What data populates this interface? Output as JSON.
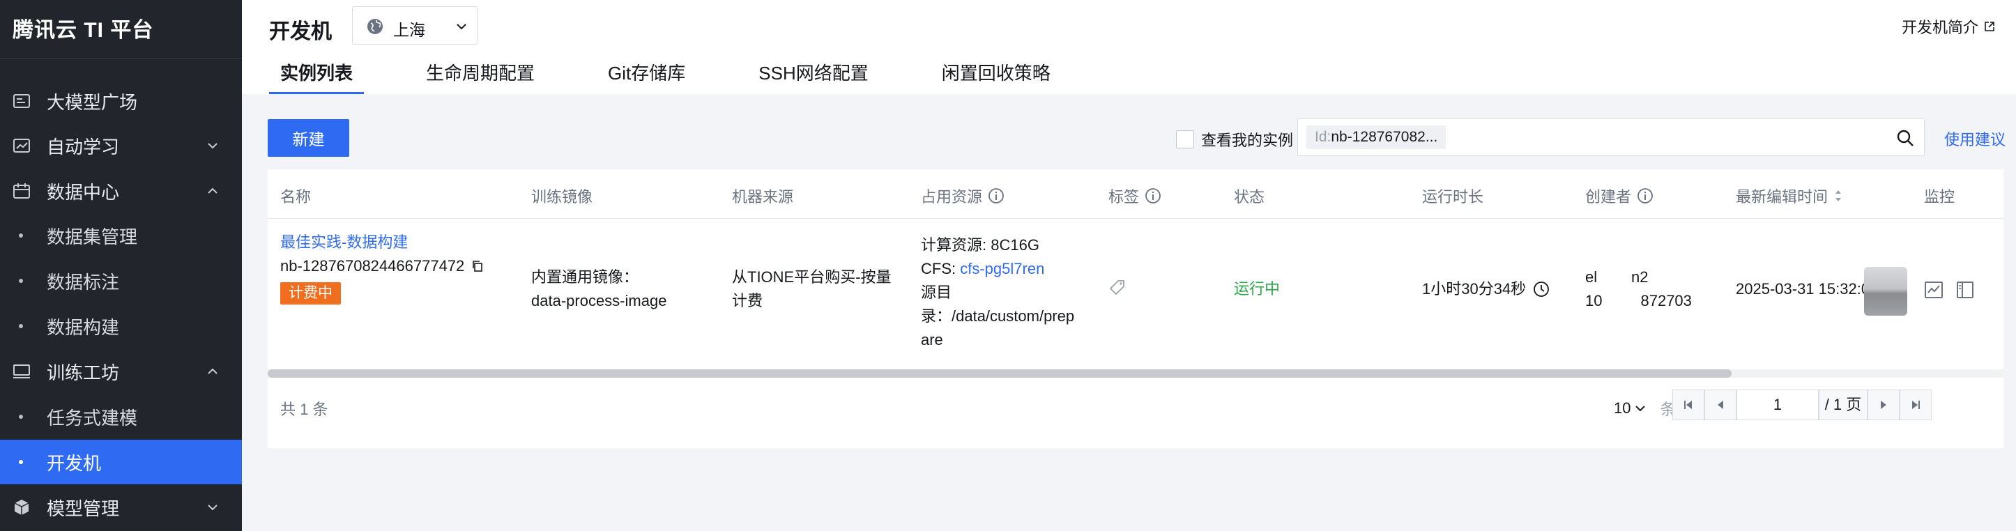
{
  "sidebar": {
    "brand": "腾讯云 TI 平台",
    "items": [
      {
        "label": "大模型广场",
        "icon": "model-square-icon"
      },
      {
        "label": "自动学习",
        "icon": "chart-icon",
        "chevron": "down"
      },
      {
        "label": "数据中心",
        "icon": "calendar-icon",
        "chevron": "up"
      },
      {
        "label": "数据集管理",
        "sub": true
      },
      {
        "label": "数据标注",
        "sub": true
      },
      {
        "label": "数据构建",
        "sub": true
      },
      {
        "label": "训练工坊",
        "icon": "monitor-icon",
        "chevron": "up"
      },
      {
        "label": "任务式建模",
        "sub": true
      },
      {
        "label": "开发机",
        "sub": true,
        "active": true
      },
      {
        "label": "模型管理",
        "icon": "cube-icon",
        "chevron": "down"
      }
    ]
  },
  "header": {
    "title": "开发机",
    "region": "上海",
    "intro_link": "开发机简介",
    "tabs": [
      "实例列表",
      "生命周期配置",
      "Git存储库",
      "SSH网络配置",
      "闲置回收策略"
    ],
    "active_tab": "实例列表"
  },
  "toolbar": {
    "new_button": "新建",
    "my_instances_label": "查看我的实例",
    "my_instances_checked": false,
    "search_tag_key": "Id:",
    "search_tag_value": "nb-128767082...",
    "suggestion_link": "使用建议"
  },
  "table": {
    "headers": {
      "name": "名称",
      "image": "训练镜像",
      "source": "机器来源",
      "resources": "占用资源",
      "tags": "标签",
      "status": "状态",
      "runtime": "运行时长",
      "creator": "创建者",
      "last_edit": "最新编辑时间",
      "monitor": "监控"
    },
    "rows": [
      {
        "name_link": "最佳实践-数据构建",
        "id": "nb-1287670824466777472",
        "billing_badge": "计费中",
        "image_line1": "内置通用镜像：",
        "image_line2": "data-process-image",
        "source_line1": "从TIONE平台购买-按量",
        "source_line2": "计费",
        "res_compute": "计算资源: 8C16G",
        "res_cfs_label": "CFS: ",
        "res_cfs_link": "cfs-pg5l7ren",
        "res_src_line1": "源目",
        "res_src_line2": "录：/data/custom/prep",
        "res_src_line3": "are",
        "status": "运行中",
        "runtime": "1小时30分34秒",
        "creator_line1": "el        n2",
        "creator_line2": "10         872703",
        "last_edit": "2025-03-31 15:32:04"
      }
    ]
  },
  "pagination": {
    "total": "共 1 条",
    "page_size": "10",
    "page_size_unit": "条 / 页",
    "current_page": "1",
    "total_pages": "/ 1 页"
  },
  "colors": {
    "sidebar_bg": "#22252b",
    "accent": "#2f6bf2",
    "running": "#2ba84a",
    "billing": "#f06e1d"
  }
}
